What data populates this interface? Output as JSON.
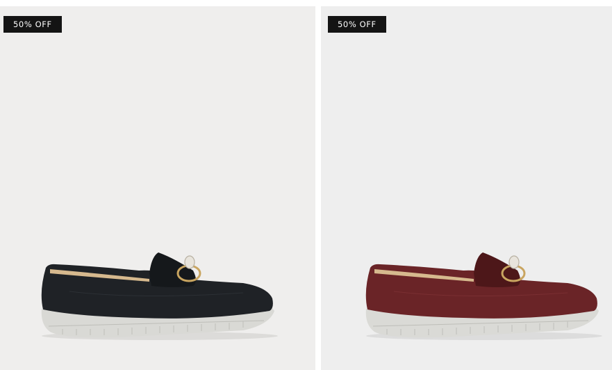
{
  "products": [
    {
      "badge": "50% OFF",
      "image": "loafer-shoe-black",
      "upper_color": "#1f2226",
      "upper_shade": "#15181b"
    },
    {
      "badge": "50% OFF",
      "image": "loafer-shoe-burgundy",
      "upper_color": "#6a2427",
      "upper_shade": "#4d1719"
    }
  ],
  "colors": {
    "badge_bg": "#141414",
    "badge_text": "#ffffff",
    "card_bg": "#efeeed",
    "sole": "#dcdcd8",
    "lining": "#d7b98e",
    "buckle_gold": "#c9a560"
  }
}
